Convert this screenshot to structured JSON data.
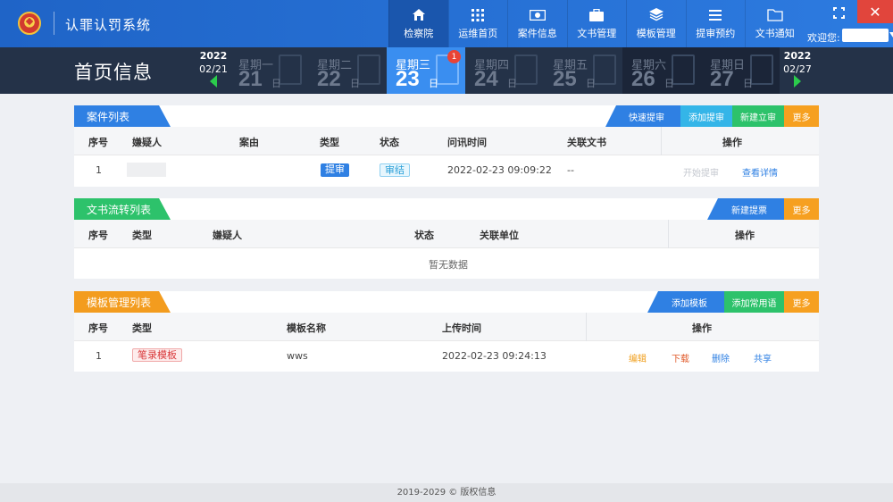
{
  "app": {
    "title": "认罪认罚系统"
  },
  "nav": [
    {
      "label": "检察院",
      "icon": "home-icon"
    },
    {
      "label": "运维首页",
      "icon": "grid-icon"
    },
    {
      "label": "案件信息",
      "icon": "money-icon"
    },
    {
      "label": "文书管理",
      "icon": "briefcase-icon"
    },
    {
      "label": "模板管理",
      "icon": "layers-icon"
    },
    {
      "label": "提审预约",
      "icon": "list-icon"
    },
    {
      "label": "文书通知",
      "icon": "folder-icon"
    }
  ],
  "header": {
    "welcome": "欢迎您:",
    "close_symbol": "✕"
  },
  "datestrip": {
    "heading": "首页信息",
    "prev": {
      "year": "2022",
      "date": "02/21"
    },
    "next": {
      "year": "2022",
      "date": "02/27"
    },
    "days": [
      {
        "weekday": "星期一",
        "day": "21",
        "suffix": "日"
      },
      {
        "weekday": "星期二",
        "day": "22",
        "suffix": "日"
      },
      {
        "weekday": "星期三",
        "day": "23",
        "suffix": "日",
        "badge": "1"
      },
      {
        "weekday": "星期四",
        "day": "24",
        "suffix": "日"
      },
      {
        "weekday": "星期五",
        "day": "25",
        "suffix": "日"
      },
      {
        "weekday": "星期六",
        "day": "26",
        "suffix": "日"
      },
      {
        "weekday": "星期日",
        "day": "27",
        "suffix": "日"
      }
    ]
  },
  "case_panel": {
    "title": "案件列表",
    "buttons": [
      "快速提审",
      "添加提审",
      "新建立审",
      "更多"
    ],
    "columns": [
      "序号",
      "嫌疑人",
      "案由",
      "类型",
      "状态",
      "问讯时间",
      "关联文书",
      "操作"
    ],
    "rows": [
      {
        "index": "1",
        "type": "提审",
        "status": "审结",
        "time": "2022-02-23 09:09:22",
        "docs": "--",
        "action_start": "开始提审",
        "action_view": "查看详情"
      }
    ]
  },
  "doc_panel": {
    "title": "文书流转列表",
    "buttons": [
      "新建提票",
      "更多"
    ],
    "columns": [
      "序号",
      "类型",
      "嫌疑人",
      "状态",
      "关联单位",
      "操作"
    ],
    "empty": "暂无数据"
  },
  "tpl_panel": {
    "title": "模板管理列表",
    "buttons": [
      "添加模板",
      "添加常用语",
      "更多"
    ],
    "columns": [
      "序号",
      "类型",
      "模板名称",
      "上传时间",
      "操作"
    ],
    "rows": [
      {
        "index": "1",
        "type": "笔录模板",
        "name": "wws",
        "time": "2022-02-23 09:24:13",
        "edit": "编辑",
        "download": "下载",
        "delete": "删除",
        "share": "共享"
      }
    ]
  },
  "footer": {
    "copyright": "2019-2029 © 版权信息"
  },
  "colors": {
    "topbar": "#2d7be0",
    "datestrip": "#243248",
    "active_day": "#3a8ef0",
    "blue_tab": "#2f80e3",
    "green_tab": "#2dc26b",
    "orange_tab": "#f39c1e",
    "btn_cyan": "#34b5e8",
    "btn_green": "#2dc26b",
    "btn_orange": "#f6a020"
  }
}
